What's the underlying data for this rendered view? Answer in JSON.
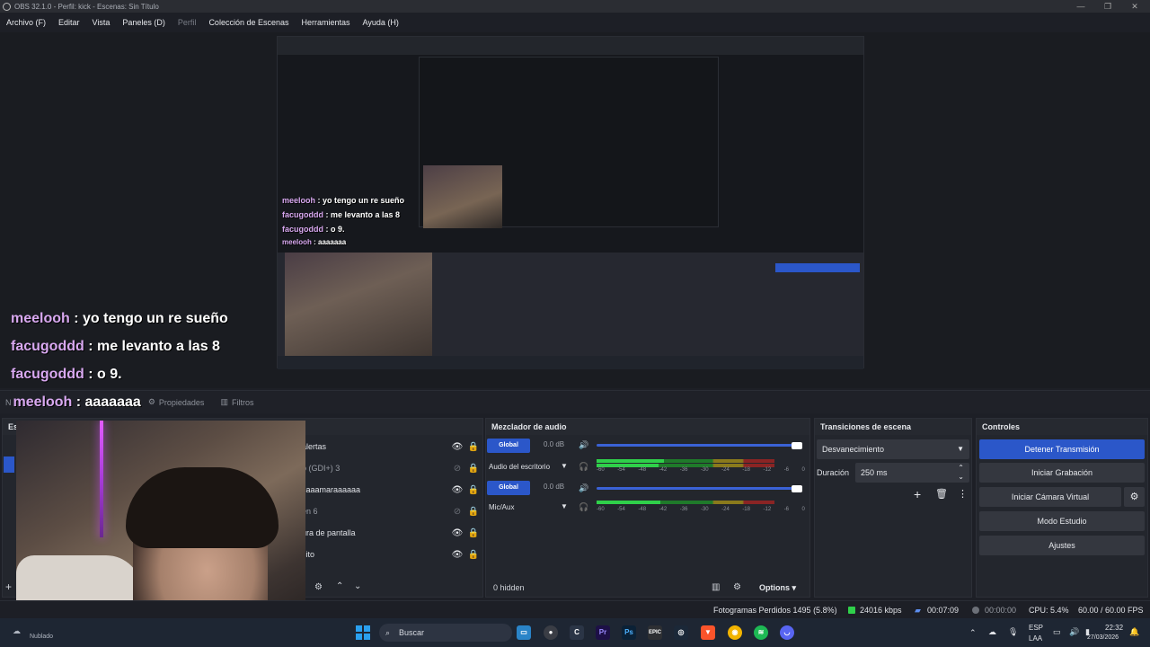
{
  "window": {
    "title": "OBS 32.1.0 - Perfil: kick - Escenas: Sin Título",
    "minimize": "—",
    "maximize": "❐",
    "close": "✕"
  },
  "menu": {
    "items": [
      "Archivo (F)",
      "Editar",
      "Vista",
      "Paneles (D)",
      "Perfil",
      "Colección de Escenas",
      "Herramientas",
      "Ayuda (H)"
    ]
  },
  "preview": {
    "chat": [
      {
        "user": "meelooh",
        "msg": " : yo tengo un re sueño"
      },
      {
        "user": "facugoddd",
        "msg": " : me levanto a las 8"
      },
      {
        "user": "facugoddd",
        "msg": " : o 9."
      },
      {
        "user": "meelooh",
        "msg": " : aaaaaaa"
      }
    ]
  },
  "tabs": {
    "first": "N",
    "properties": "Propiedades",
    "filters": "Filtros"
  },
  "panels": {
    "scenes_header": "Esc",
    "mixer_header": "Mezclador de audio",
    "transitions_header": "Transiciones de escena",
    "controls_header": "Controles"
  },
  "sources": [
    {
      "name": "alertas",
      "visible": true,
      "locked": true
    },
    {
      "name": "o (GDI+) 3",
      "visible": false,
      "locked": true
    },
    {
      "name": "caaamaraaaaaa",
      "visible": true,
      "locked": true
    },
    {
      "name": "en 6",
      "visible": false,
      "locked": true
    },
    {
      "name": "ura de pantalla",
      "visible": true,
      "locked": true
    },
    {
      "name": "cito",
      "visible": true,
      "locked": true
    }
  ],
  "mixer": {
    "channels": [
      {
        "button": "Global",
        "db": "0.0 dB",
        "label": "Audio del escritorio",
        "level": 0.38
      },
      {
        "button": "Global",
        "db": "0.0 dB",
        "label": "Mic/Aux",
        "level": 0.36
      }
    ],
    "scale": [
      "-60",
      "-54",
      "-48",
      "-42",
      "-36",
      "-30",
      "-24",
      "-18",
      "-12",
      "-6",
      "0"
    ],
    "hidden": "0 hidden",
    "options": "Options"
  },
  "transitions": {
    "selected": "Desvanecimiento",
    "duration_label": "Duración",
    "duration_value": "250 ms"
  },
  "controls": {
    "stop_stream": "Detener Transmisión",
    "start_record": "Iniciar Grabación",
    "virtual_cam": "Iniciar Cámara Virtual",
    "studio_mode": "Modo Estudio",
    "settings": "Ajustes"
  },
  "status": {
    "dropped": "Fotogramas Perdidos 1495 (5.8%)",
    "bitrate": "24016 kbps",
    "stream_time": "00:07:09",
    "rec_time": "00:00:00",
    "cpu": "CPU: 5.4%",
    "fps": "60.00 / 60.00 FPS"
  },
  "taskbar": {
    "weather": "Nublado",
    "search": "Buscar",
    "lang1": "ESP",
    "lang2": "LAA",
    "time": "22:32",
    "date": "27/03/2026"
  },
  "colors": {
    "accent": "#2b57c9",
    "chat_user": "#d8a8f0"
  }
}
